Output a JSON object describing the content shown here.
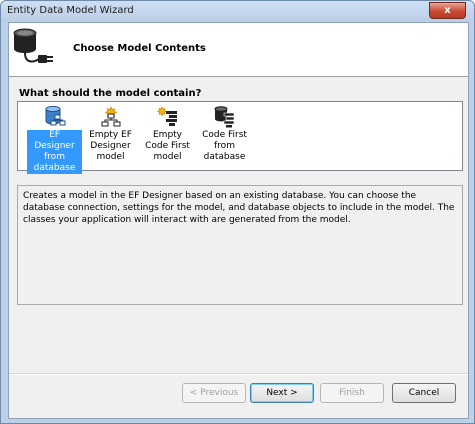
{
  "window": {
    "title": "Entity Data Model Wizard",
    "close_glyph": "x"
  },
  "header": {
    "title": "Choose Model Contents",
    "icon": "database-plug-icon"
  },
  "question": "What should the model contain?",
  "options": [
    {
      "label": "EF Designer from database",
      "icon": "ef-designer-from-database-icon",
      "selected": true
    },
    {
      "label": "Empty EF Designer model",
      "icon": "empty-ef-designer-model-icon",
      "selected": false
    },
    {
      "label": "Empty Code First model",
      "icon": "empty-code-first-icon",
      "selected": false
    },
    {
      "label": "Code First from database",
      "icon": "code-first-from-database-icon",
      "selected": false
    }
  ],
  "description": "Creates a model in the EF Designer based on an existing database. You can choose the database connection, settings for the model, and database objects to include in the model. The classes your application will interact with are generated from the model.",
  "buttons": {
    "previous": "< Previous",
    "next": "Next >",
    "finish": "Finish",
    "cancel": "Cancel"
  },
  "colors": {
    "selection": "#3399ff",
    "titlebar": "#bcd0e8",
    "close": "#c94a32"
  }
}
